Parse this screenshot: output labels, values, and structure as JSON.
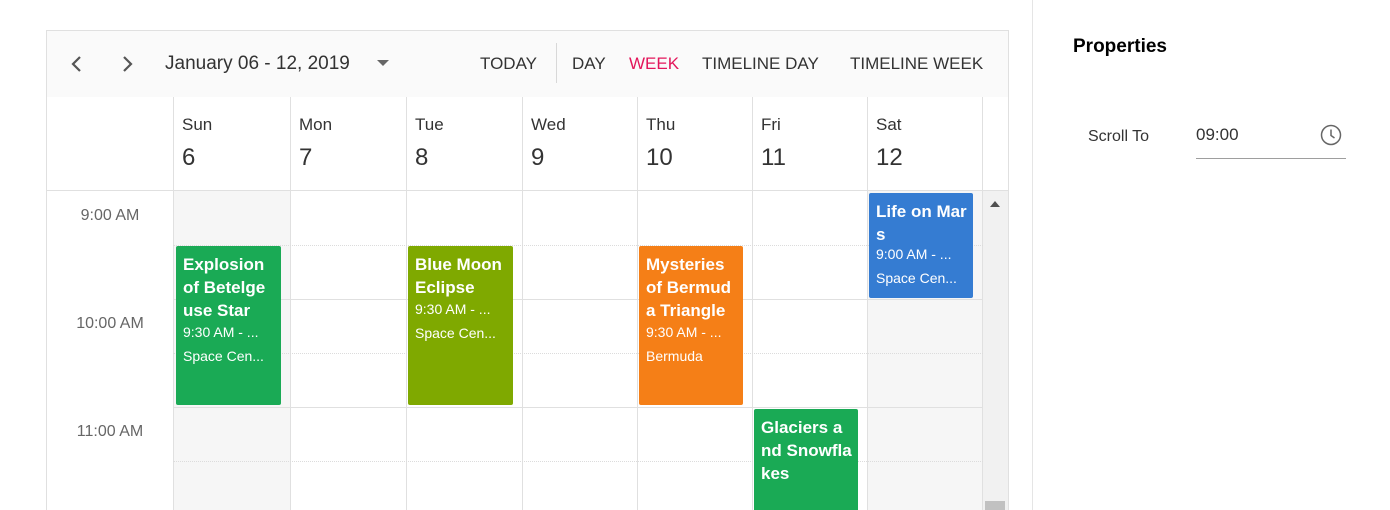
{
  "toolbar": {
    "date_range": "January 06 - 12, 2019",
    "today": "TODAY",
    "views": [
      "DAY",
      "WEEK",
      "TIMELINE DAY",
      "TIMELINE WEEK"
    ],
    "active_view": "WEEK",
    "active_color": "#e3165b",
    "icons": [
      "chevron-left-icon",
      "chevron-right-icon",
      "caret-down-icon"
    ]
  },
  "days": [
    {
      "name": "Sun",
      "num": "6"
    },
    {
      "name": "Mon",
      "num": "7"
    },
    {
      "name": "Tue",
      "num": "8"
    },
    {
      "name": "Wed",
      "num": "9"
    },
    {
      "name": "Thu",
      "num": "10"
    },
    {
      "name": "Fri",
      "num": "11"
    },
    {
      "name": "Sat",
      "num": "12"
    }
  ],
  "times": [
    "9:00 AM",
    "10:00 AM",
    "11:00 AM"
  ],
  "events": [
    {
      "title": "Explosion of Betelgeuse Star",
      "time": "9:30 AM - ...",
      "location": "Space Cen...",
      "color": "#1aaa55",
      "day": "Sun"
    },
    {
      "title": "Blue Moon Eclipse",
      "time": "9:30 AM - ...",
      "location": "Space Cen...",
      "color": "#7fa900",
      "day": "Tue"
    },
    {
      "title": "Mysteries of Bermuda Triangle",
      "time": "9:30 AM - ...",
      "location": "Bermuda",
      "color": "#f57f17",
      "day": "Thu"
    },
    {
      "title": "Life on Mars",
      "time": "9:00 AM - ...",
      "location": "Space Cen...",
      "color": "#357cd2",
      "day": "Sat"
    },
    {
      "title": "Glaciers and Snowflakes",
      "time": "",
      "location": "",
      "color": "#1aaa55",
      "day": "Fri"
    }
  ],
  "properties": {
    "title": "Properties",
    "scroll_to_label": "Scroll To",
    "scroll_to_value": "09:00",
    "icon": "clock-icon"
  }
}
